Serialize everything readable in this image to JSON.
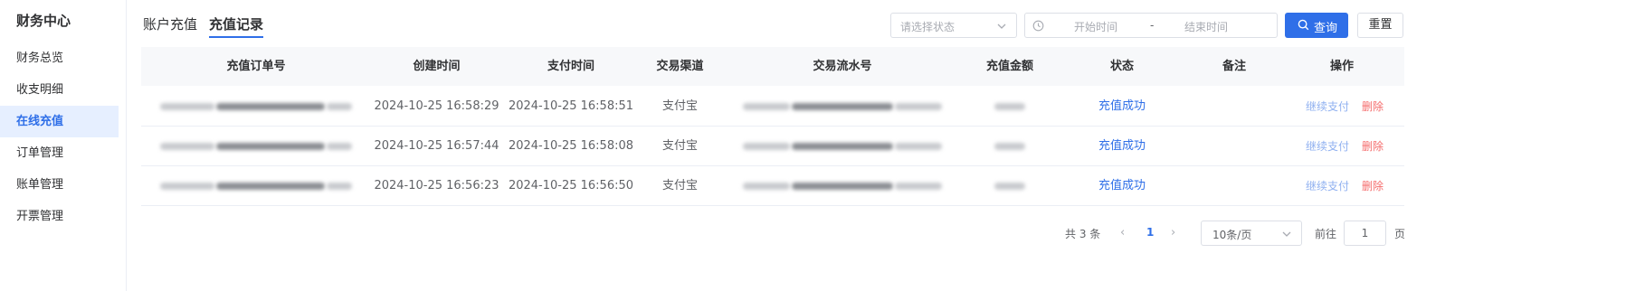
{
  "sidebar": {
    "title": "财务中心",
    "items": [
      {
        "label": "财务总览",
        "active": false
      },
      {
        "label": "收支明细",
        "active": false
      },
      {
        "label": "在线充值",
        "active": true
      },
      {
        "label": "订单管理",
        "active": false
      },
      {
        "label": "账单管理",
        "active": false
      },
      {
        "label": "开票管理",
        "active": false
      }
    ]
  },
  "tabs": [
    {
      "label": "账户充值",
      "active": false
    },
    {
      "label": "充值记录",
      "active": true
    }
  ],
  "filters": {
    "status_placeholder": "请选择状态",
    "date_start_placeholder": "开始时间",
    "date_separator": "-",
    "date_end_placeholder": "结束时间",
    "query_label": "查询",
    "reset_label": "重置",
    "icons": {
      "search": "search-icon",
      "clock": "clock-icon",
      "dropdown": "chevron-down-icon"
    }
  },
  "table": {
    "columns": [
      "充值订单号",
      "创建时间",
      "支付时间",
      "交易渠道",
      "交易流水号",
      "充值金额",
      "状态",
      "备注",
      "操作"
    ],
    "rows": [
      {
        "created": "2024-10-25 16:58:29",
        "paid": "2024-10-25 16:58:51",
        "channel": "支付宝",
        "status": "充值成功",
        "remark": "",
        "action_pay": "继续支付",
        "action_delete": "删除"
      },
      {
        "created": "2024-10-25 16:57:44",
        "paid": "2024-10-25 16:58:08",
        "channel": "支付宝",
        "status": "充值成功",
        "remark": "",
        "action_pay": "继续支付",
        "action_delete": "删除"
      },
      {
        "created": "2024-10-25 16:56:23",
        "paid": "2024-10-25 16:56:50",
        "channel": "支付宝",
        "status": "充值成功",
        "remark": "",
        "action_pay": "继续支付",
        "action_delete": "删除"
      }
    ]
  },
  "pagination": {
    "total": "共 3 条",
    "current_page": "1",
    "page_size": "10条/页",
    "goto_label": "前往",
    "goto_value": "1",
    "page_suffix": "页"
  },
  "colors": {
    "accent": "#2f6fe8",
    "danger": "#f56c6c",
    "active_bg": "#e6efff"
  }
}
